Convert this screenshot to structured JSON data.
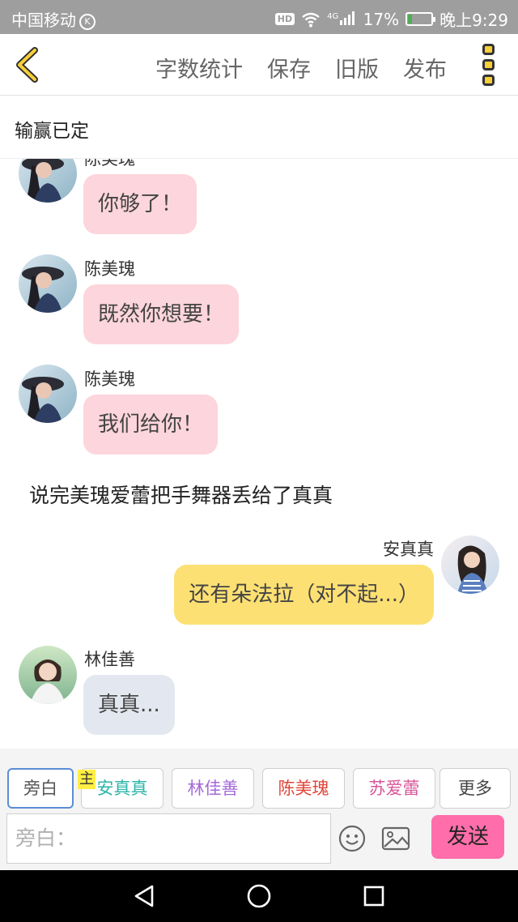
{
  "status_bar": {
    "carrier": "中国移动",
    "carrier_badge": "K",
    "hd": "HD",
    "network": "4G",
    "battery_text": "17%",
    "battery_level": 0.17,
    "time": "晚上9:29"
  },
  "toolbar": {
    "actions": [
      "字数统计",
      "保存",
      "旧版",
      "发布"
    ]
  },
  "title": "输赢已定",
  "messages": [
    {
      "name": "陈美瑰",
      "text": "你够了！"
    },
    {
      "name": "陈美瑰",
      "text": "既然你想要！"
    },
    {
      "name": "陈美瑰",
      "text": "我们给你！"
    },
    {
      "narration": "说完美瑰爱蕾把手舞器丢给了真真"
    },
    {
      "name": "安真真",
      "text": "还有朵法拉（对不起...）"
    },
    {
      "name": "林佳善",
      "text": "真真..."
    }
  ],
  "roles": {
    "chips": [
      {
        "label": "旁白",
        "color": "#555555"
      },
      {
        "label": "安真真",
        "color": "#2bb5a8"
      },
      {
        "label": "林佳善",
        "color": "#a36ad8"
      },
      {
        "label": "陈美瑰",
        "color": "#e0453a"
      },
      {
        "label": "苏爱蕾",
        "color": "#d8579a"
      },
      {
        "label": "更多",
        "color": "#444444"
      }
    ],
    "main_badge": "主"
  },
  "composer": {
    "placeholder": "旁白：",
    "send_label": "发送"
  },
  "colors": {
    "accent_yellow": "#f6cf3a",
    "send_pink": "#ff6eaa",
    "bubble_pink": "#fdd5dc",
    "bubble_yellow": "#fde073",
    "bubble_gray": "#e3e8f0"
  }
}
